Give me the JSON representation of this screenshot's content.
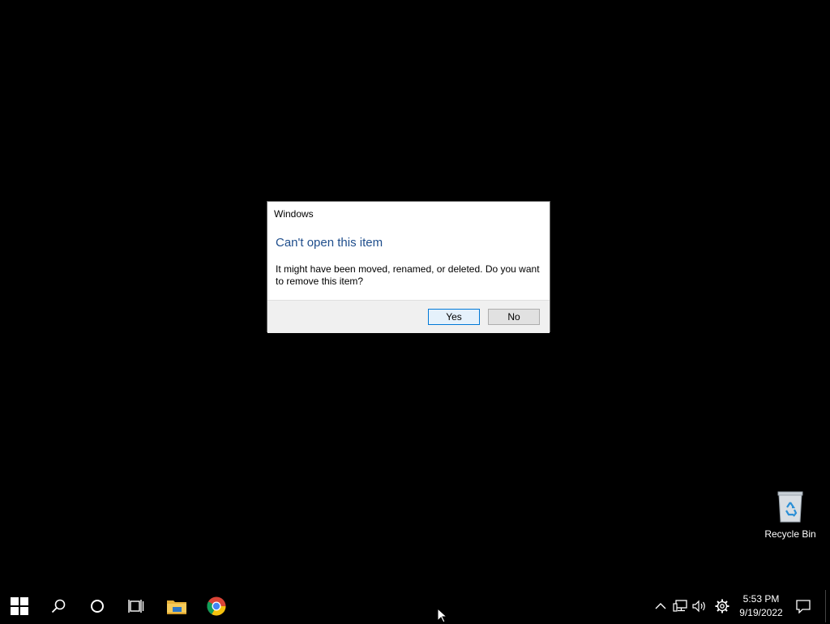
{
  "dialog": {
    "title": "Windows",
    "heading": "Can't open this item",
    "message": "It might have been moved, renamed, or deleted. Do you want to remove this item?",
    "yes_label": "Yes",
    "no_label": "No",
    "heading_color": "#1f4e8c"
  },
  "desktop": {
    "icons": [
      {
        "label": "Recycle Bin",
        "icon": "recycle-bin-icon"
      }
    ]
  },
  "taskbar": {
    "items": [
      {
        "name": "start-button",
        "icon": "windows-logo-icon"
      },
      {
        "name": "search-button",
        "icon": "search-icon"
      },
      {
        "name": "cortana-button",
        "icon": "cortana-circle-icon"
      },
      {
        "name": "task-view-button",
        "icon": "task-view-icon"
      },
      {
        "name": "file-explorer-button",
        "icon": "folder-icon"
      },
      {
        "name": "chrome-button",
        "icon": "chrome-icon"
      }
    ],
    "tray": {
      "icons": [
        "chevron-up-icon",
        "network-icon",
        "volume-icon",
        "gear-icon"
      ],
      "time": "5:53 PM",
      "date": "9/19/2022",
      "notification_icon": "action-center-icon"
    }
  }
}
